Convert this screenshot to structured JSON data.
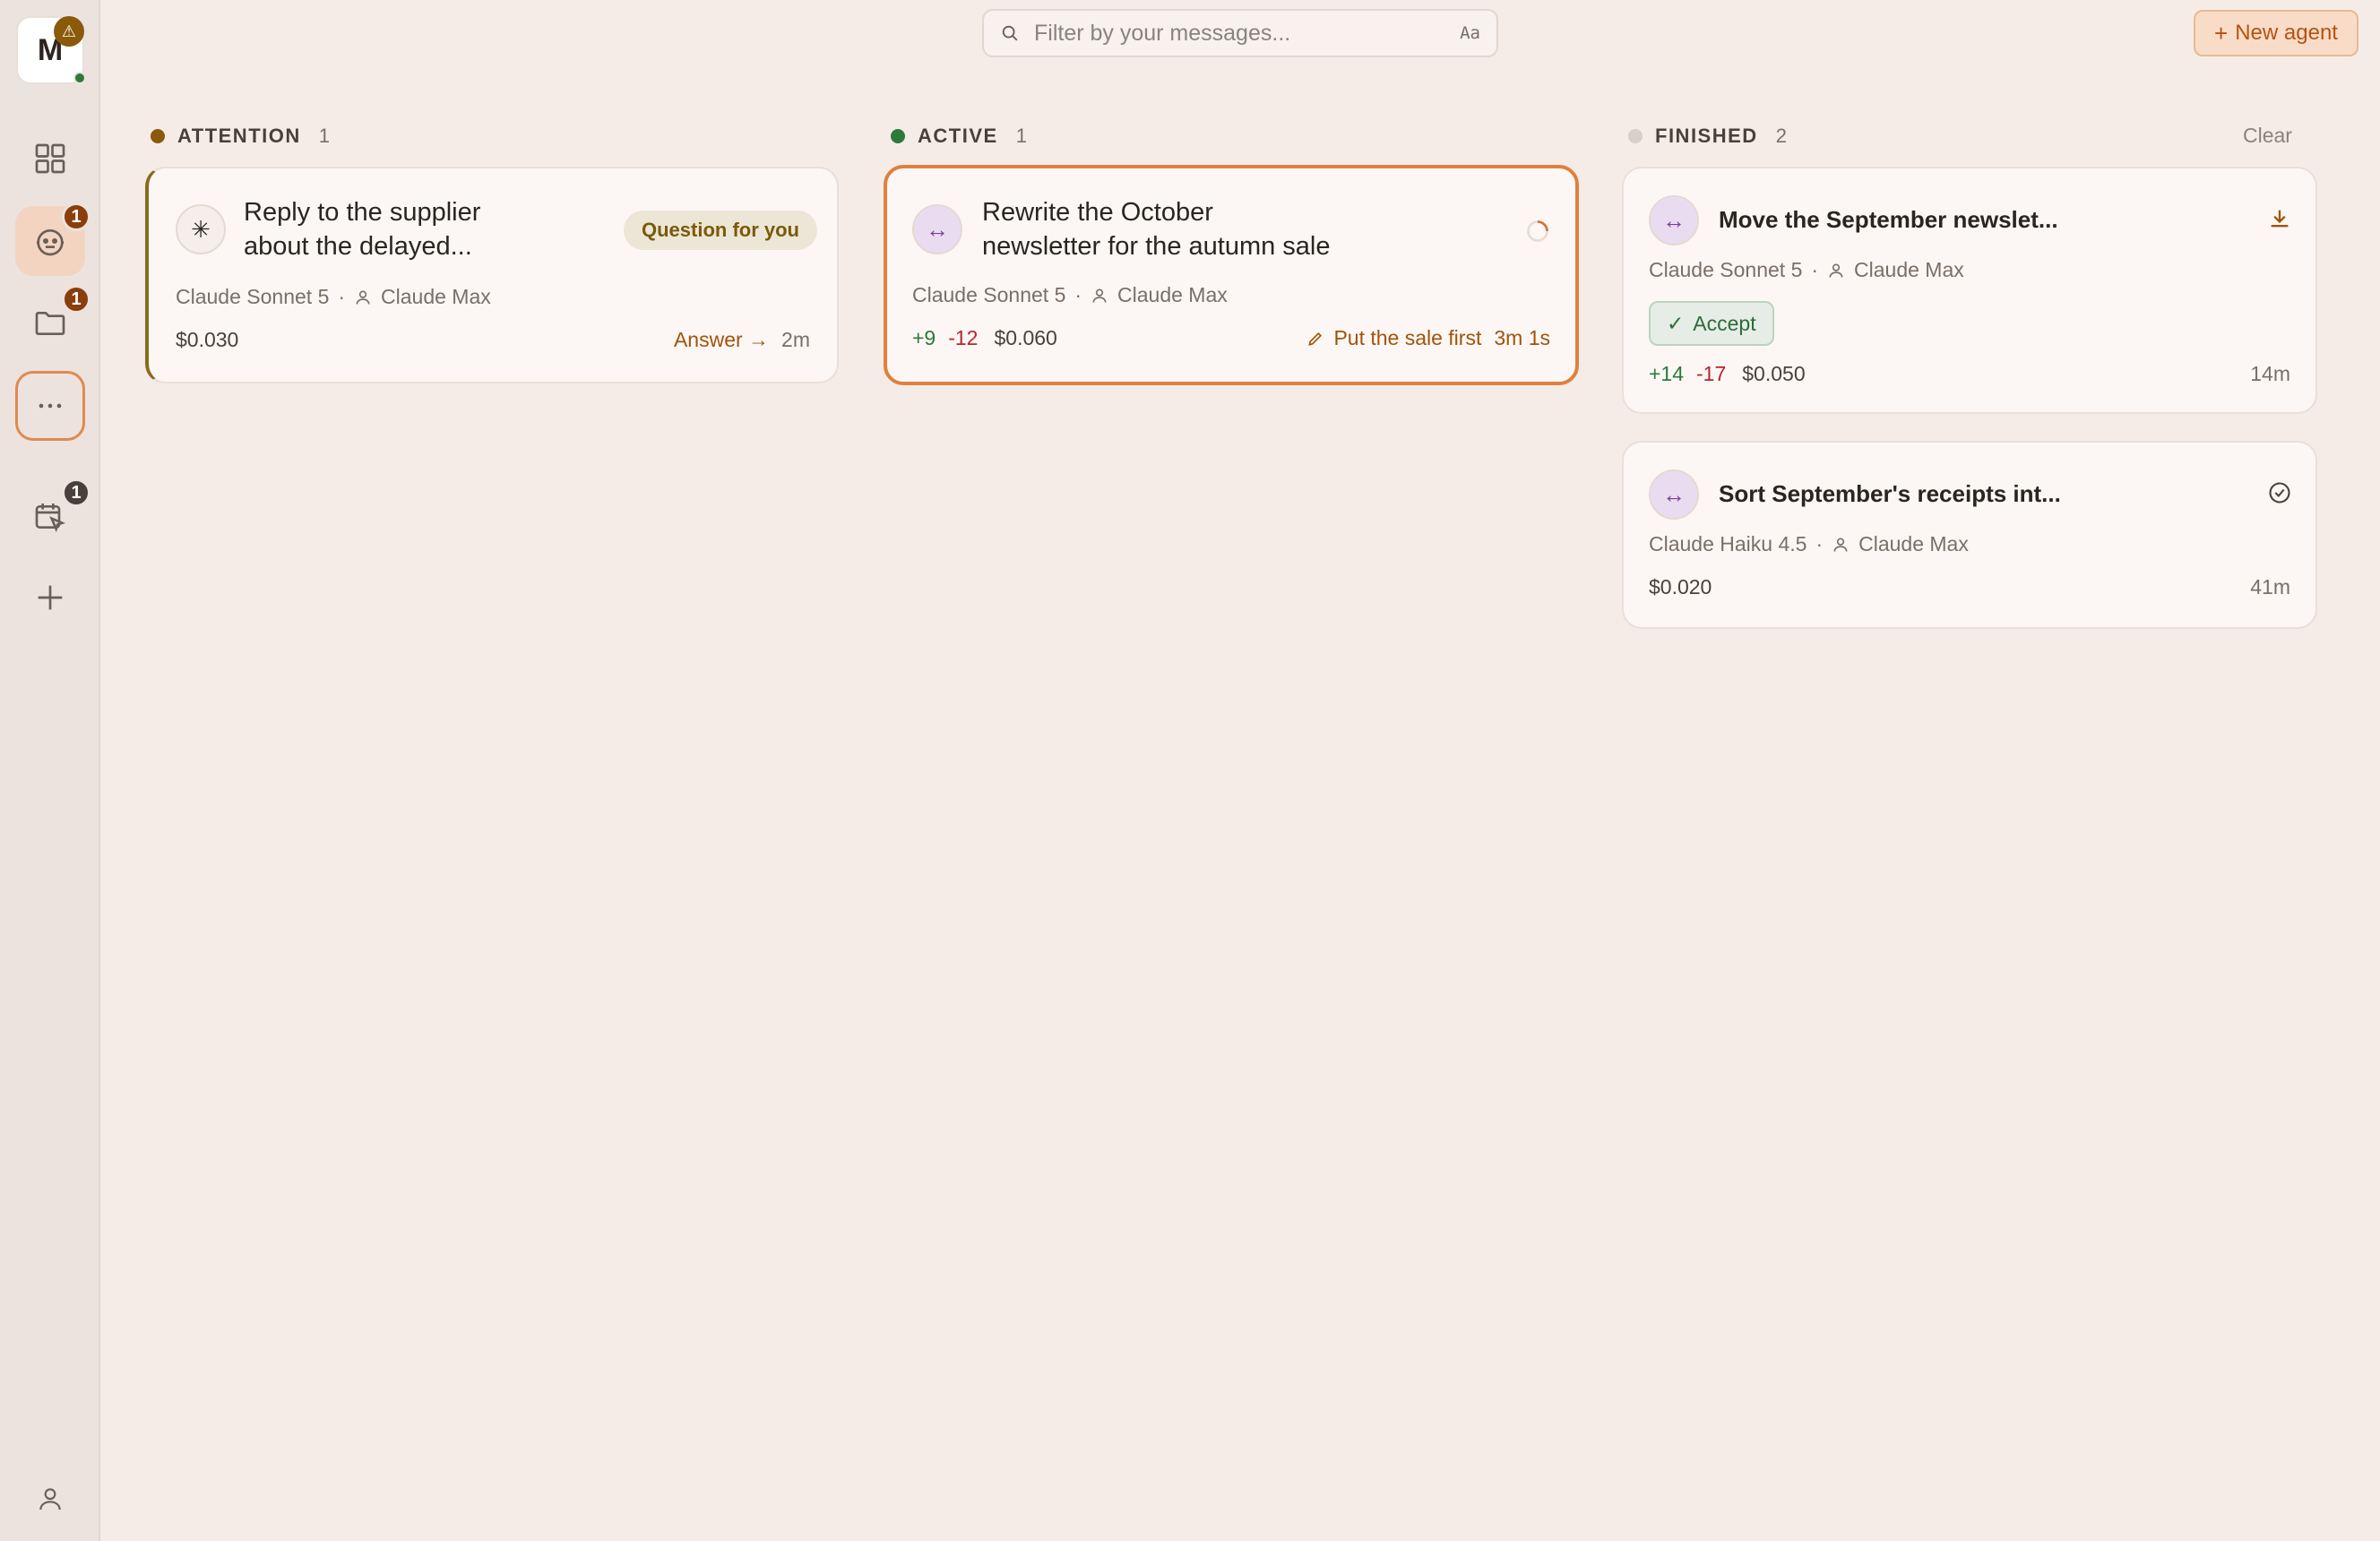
{
  "sidebar": {
    "avatar_letter": "M",
    "avatar_warning": "⚠",
    "badges": {
      "agents": "1",
      "files": "1",
      "scheduled": "1"
    }
  },
  "search": {
    "placeholder": "Filter by your messages...",
    "case_toggle": "Aa"
  },
  "new_agent_label": "New agent",
  "columns": {
    "attention": {
      "label": "ATTENTION",
      "count": "1",
      "color": "#8a6a1a"
    },
    "active": {
      "label": "ACTIVE",
      "count": "1",
      "color": "#2d7a3a"
    },
    "finished": {
      "label": "FINISHED",
      "count": "2",
      "color": "#d9cfca",
      "clear_label": "Clear"
    }
  },
  "cards": {
    "attention": [
      {
        "title_line1": "Reply to the supplier",
        "title_line2": "about the delayed...",
        "tag": "Question for you",
        "model": "Claude Sonnet 5",
        "account": "Claude Max",
        "cost": "$0.030",
        "action": "Answer",
        "age": "2m"
      }
    ],
    "active": [
      {
        "title_line1": "Rewrite the October",
        "title_line2": "newsletter for the autumn sale",
        "model": "Claude Sonnet 5",
        "account": "Claude Max",
        "added": "+9",
        "removed": "-12",
        "cost": "$0.060",
        "current_step": "Put the sale first",
        "elapsed": "3m 1s"
      }
    ],
    "finished": [
      {
        "title": "Move the September newslet...",
        "model": "Claude Sonnet 5",
        "account": "Claude Max",
        "accept_label": "Accept",
        "added": "+14",
        "removed": "-17",
        "cost": "$0.050",
        "age": "14m"
      },
      {
        "title": "Sort September's receipts int...",
        "model": "Claude Haiku 4.5",
        "account": "Claude Max",
        "cost": "$0.020",
        "age": "41m"
      }
    ]
  }
}
